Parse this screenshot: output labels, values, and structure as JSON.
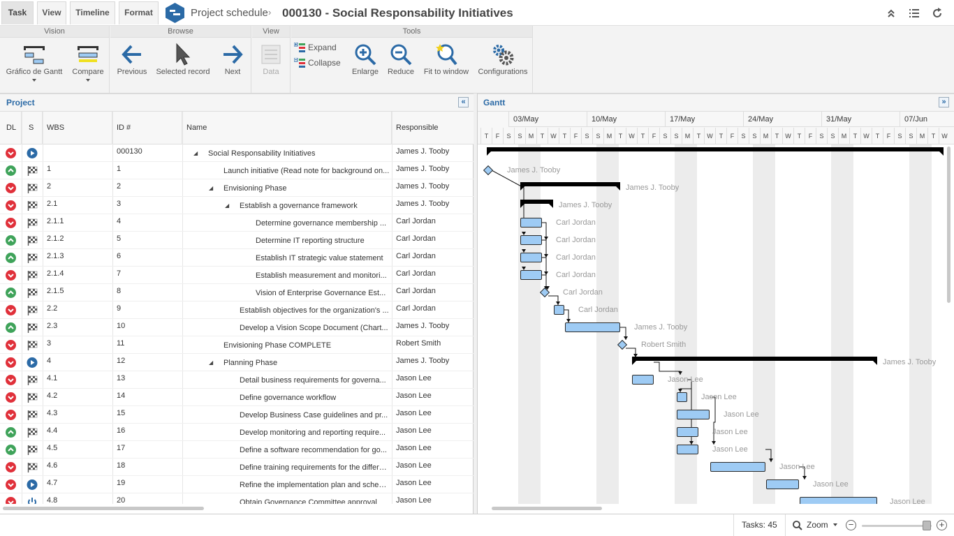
{
  "tabs": [
    {
      "label": "Task",
      "active": true
    },
    {
      "label": "View",
      "active": false
    },
    {
      "label": "Timeline",
      "active": false
    },
    {
      "label": "Format",
      "active": false
    }
  ],
  "header": {
    "breadcrumb": "Project schedule",
    "title": "000130 - Social Responsability Initiatives",
    "icons": [
      "collapse-up-icon",
      "list-icon",
      "refresh-icon"
    ]
  },
  "ribbon": {
    "vision": {
      "label": "Vision",
      "gantt_label": "Gráfico de Gantt",
      "compare_label": "Compare"
    },
    "browse": {
      "label": "Browse",
      "previous_label": "Previous",
      "selected_label": "Selected record",
      "next_label": "Next"
    },
    "view": {
      "label": "View",
      "data_label": "Data"
    },
    "tools": {
      "label": "Tools",
      "expand_label": "Expand",
      "collapse_label": "Collapse",
      "enlarge_label": "Enlarge",
      "reduce_label": "Reduce",
      "fit_label": "Fit to window",
      "config_label": "Configurations"
    }
  },
  "project_panel": {
    "title": "Project",
    "columns": [
      "DL",
      "S",
      "WBS",
      "ID #",
      "Name",
      "Responsible"
    ],
    "rows": [
      {
        "dl": "down",
        "s": "play",
        "wbs": "",
        "id": "000130",
        "name": "Social Responsability Initiatives",
        "level": 0,
        "expander": true,
        "resp": "James J. Tooby"
      },
      {
        "dl": "up",
        "s": "flag",
        "wbs": "1",
        "id": "1",
        "name": "Launch initiative (Read note for background on...",
        "level": 1,
        "expander": false,
        "resp": "James J. Tooby"
      },
      {
        "dl": "down",
        "s": "flag",
        "wbs": "2",
        "id": "2",
        "name": "Envisioning Phase",
        "level": 1,
        "expander": true,
        "resp": "James J. Tooby"
      },
      {
        "dl": "down",
        "s": "flag",
        "wbs": "2.1",
        "id": "3",
        "name": "Establish a governance framework",
        "level": 2,
        "expander": true,
        "resp": "James J. Tooby"
      },
      {
        "dl": "down",
        "s": "flag",
        "wbs": "2.1.1",
        "id": "4",
        "name": "Determine governance membership ...",
        "level": 3,
        "expander": false,
        "resp": "Carl Jordan"
      },
      {
        "dl": "up",
        "s": "flag",
        "wbs": "2.1.2",
        "id": "5",
        "name": "Determine IT reporting structure",
        "level": 3,
        "expander": false,
        "resp": "Carl Jordan"
      },
      {
        "dl": "up",
        "s": "flag",
        "wbs": "2.1.3",
        "id": "6",
        "name": "Establish IT strategic value statement",
        "level": 3,
        "expander": false,
        "resp": "Carl Jordan"
      },
      {
        "dl": "down",
        "s": "flag",
        "wbs": "2.1.4",
        "id": "7",
        "name": "Establish measurement and monitori...",
        "level": 3,
        "expander": false,
        "resp": "Carl Jordan"
      },
      {
        "dl": "up",
        "s": "flag",
        "wbs": "2.1.5",
        "id": "8",
        "name": "Vision of Enterprise Governance Est...",
        "level": 3,
        "expander": false,
        "resp": "Carl Jordan"
      },
      {
        "dl": "down",
        "s": "flag",
        "wbs": "2.2",
        "id": "9",
        "name": "Establish objectives for the organization's ...",
        "level": 2,
        "expander": false,
        "resp": "Carl Jordan"
      },
      {
        "dl": "up",
        "s": "flag",
        "wbs": "2.3",
        "id": "10",
        "name": "Develop a Vision Scope Document (Chart...",
        "level": 2,
        "expander": false,
        "resp": "James J. Tooby"
      },
      {
        "dl": "down",
        "s": "flag",
        "wbs": "3",
        "id": "11",
        "name": "Envisioning Phase COMPLETE",
        "level": 1,
        "expander": false,
        "resp": "Robert Smith"
      },
      {
        "dl": "down",
        "s": "play",
        "wbs": "4",
        "id": "12",
        "name": "Planning Phase",
        "level": 1,
        "expander": true,
        "resp": "James J. Tooby"
      },
      {
        "dl": "down",
        "s": "flag",
        "wbs": "4.1",
        "id": "13",
        "name": "Detail business requirements for governa...",
        "level": 2,
        "expander": false,
        "resp": "Jason Lee"
      },
      {
        "dl": "down",
        "s": "flag",
        "wbs": "4.2",
        "id": "14",
        "name": "Define governance workflow",
        "level": 2,
        "expander": false,
        "resp": "Jason Lee"
      },
      {
        "dl": "down",
        "s": "flag",
        "wbs": "4.3",
        "id": "15",
        "name": "Develop Business Case guidelines and pr...",
        "level": 2,
        "expander": false,
        "resp": "Jason Lee"
      },
      {
        "dl": "up",
        "s": "flag",
        "wbs": "4.4",
        "id": "16",
        "name": "Develop monitoring and reporting require...",
        "level": 2,
        "expander": false,
        "resp": "Jason Lee"
      },
      {
        "dl": "up",
        "s": "flag",
        "wbs": "4.5",
        "id": "17",
        "name": "Define a software recommendation for go...",
        "level": 2,
        "expander": false,
        "resp": "Jason Lee"
      },
      {
        "dl": "down",
        "s": "flag",
        "wbs": "4.6",
        "id": "18",
        "name": "Define training requirements for the differe...",
        "level": 2,
        "expander": false,
        "resp": "Jason Lee"
      },
      {
        "dl": "down",
        "s": "play",
        "wbs": "4.7",
        "id": "19",
        "name": "Refine the implementation plan and schedule",
        "level": 2,
        "expander": false,
        "resp": "Jason Lee"
      },
      {
        "dl": "down",
        "s": "power",
        "wbs": "4.8",
        "id": "20",
        "name": "Obtain Governance Committee approval",
        "level": 2,
        "expander": false,
        "resp": "Jason Lee"
      }
    ]
  },
  "gantt_panel": {
    "title": "Gantt",
    "weeks": [
      "03/May",
      "10/May",
      "17/May",
      "24/May",
      "31/May",
      "07/Jun"
    ],
    "day_letters": [
      "T",
      "F",
      "S",
      "S",
      "M",
      "T",
      "W",
      "T",
      "F",
      "S",
      "S",
      "M",
      "T",
      "W",
      "T",
      "F",
      "S",
      "S",
      "M",
      "T",
      "W",
      "T",
      "F",
      "S",
      "S",
      "M",
      "T",
      "W",
      "T",
      "F",
      "S",
      "S",
      "M",
      "T",
      "W",
      "T",
      "F",
      "S",
      "S",
      "M",
      "T",
      "W"
    ]
  },
  "status": {
    "tasks": "Tasks: 45",
    "zoom": "Zoom",
    "zoom_level": 0.9
  },
  "colors": {
    "accent": "#2b6aa6",
    "bar_fill": "#9ecbf4",
    "dl_down": "#e0303a",
    "dl_up": "#3fa35a"
  }
}
